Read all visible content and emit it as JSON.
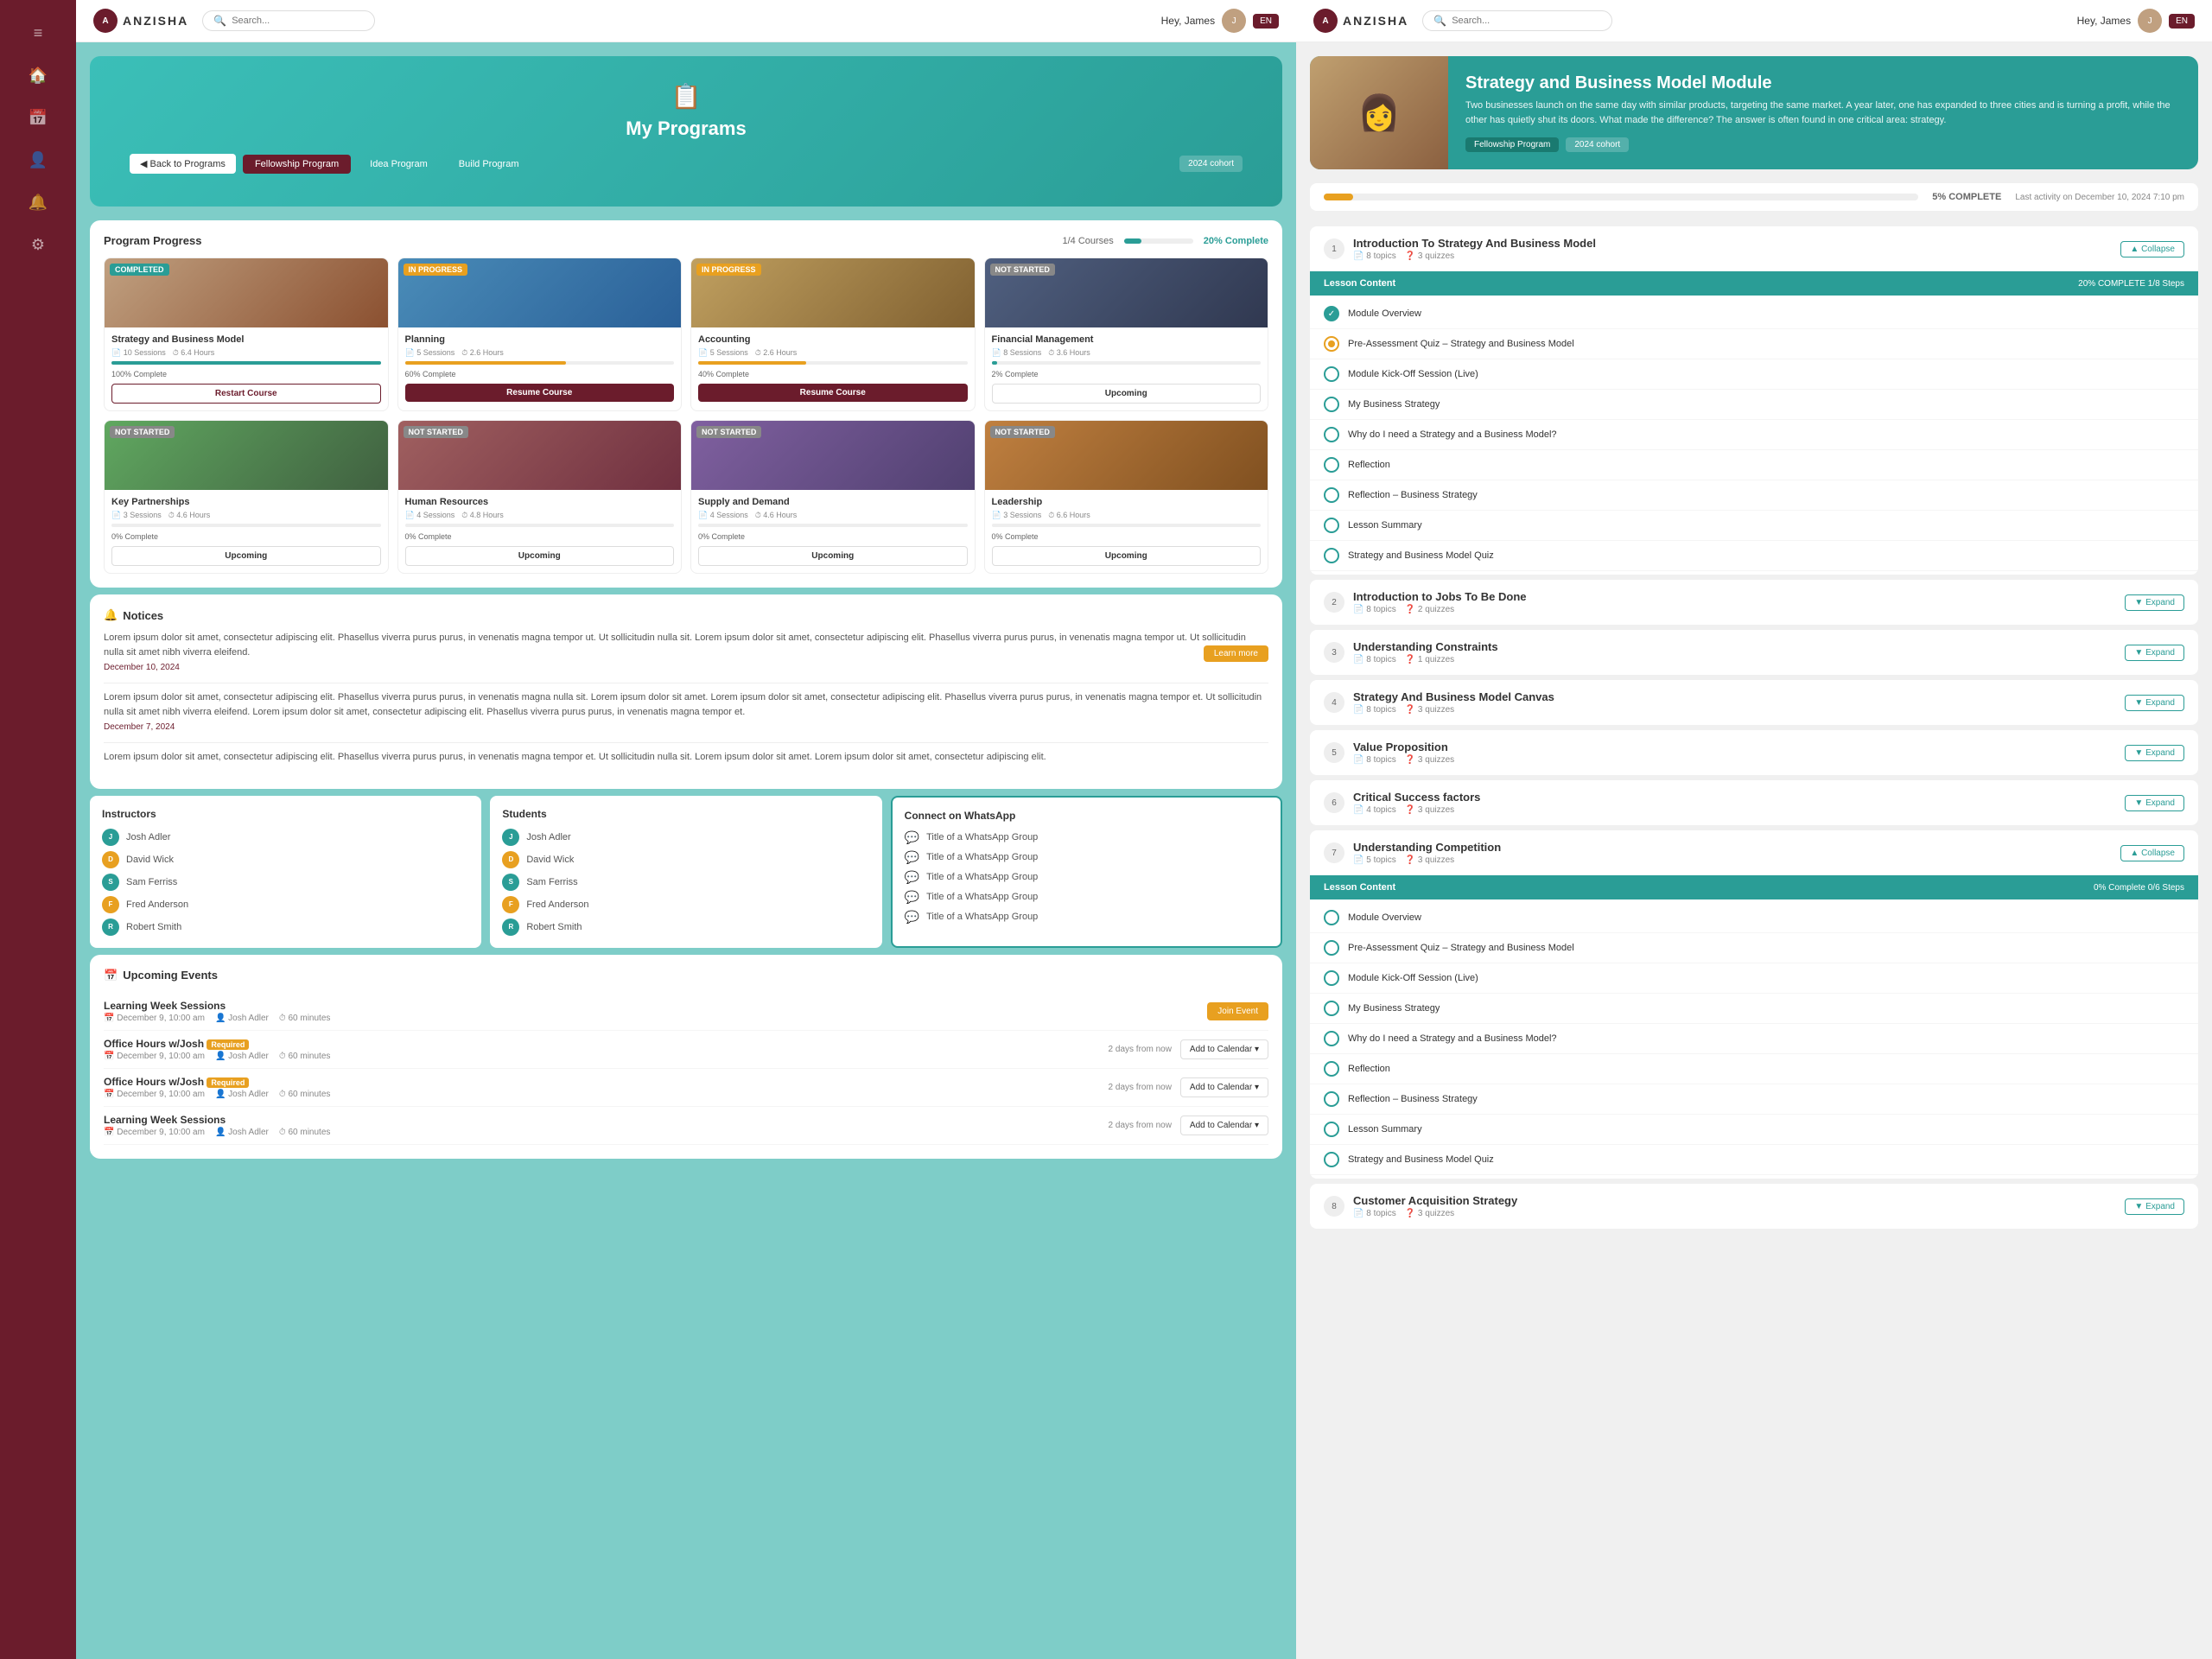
{
  "app": {
    "name": "ANZISHA",
    "lang": "EN"
  },
  "left_topbar": {
    "logo_text": "ANZISHA",
    "search_placeholder": "Search...",
    "greeting": "Hey, James",
    "avatar_initials": "J"
  },
  "right_topbar": {
    "logo_text": "ANZISHA",
    "search_placeholder": "Search...",
    "greeting": "Hey, James",
    "avatar_initials": "J",
    "lang": "EN"
  },
  "hero": {
    "icon": "📋",
    "title": "My Programs"
  },
  "program_tabs": {
    "back_label": "◀ Back to Programs",
    "tabs": [
      "Fellowship Program",
      "Idea Program",
      "Build Program"
    ],
    "active_tab": "Fellowship Program",
    "cohort": "2024 cohort"
  },
  "program_progress": {
    "title": "Program Progress",
    "courses_meta": "1/4 Courses",
    "completion": "20% Complete",
    "courses": [
      {
        "name": "Strategy and Business Model",
        "status": "COMPLETED",
        "status_class": "badge-completed",
        "sessions": "10 Sessions",
        "hours": "6.4 Hours",
        "progress": 100,
        "progress_class": "progress-green",
        "pct_text": "100% Complete",
        "btn_label": "Restart Course",
        "btn_class": "btn-restart",
        "thumb_class": "thumb-1"
      },
      {
        "name": "Planning",
        "status": "IN PROGRESS",
        "status_class": "badge-in-progress",
        "sessions": "5 Sessions",
        "hours": "2.6 Hours",
        "progress": 60,
        "progress_class": "progress-orange",
        "pct_text": "60% Complete",
        "btn_label": "Resume Course",
        "btn_class": "btn-resume",
        "thumb_class": "thumb-2"
      },
      {
        "name": "Accounting",
        "status": "IN PROGRESS",
        "status_class": "badge-in-progress",
        "sessions": "5 Sessions",
        "hours": "2.6 Hours",
        "progress": 40,
        "progress_class": "progress-orange",
        "pct_text": "40% Complete",
        "btn_label": "Resume Course",
        "btn_class": "btn-resume",
        "thumb_class": "thumb-3"
      },
      {
        "name": "Financial Management",
        "status": "NOT STARTED",
        "status_class": "badge-not-started",
        "sessions": "8 Sessions",
        "hours": "3.6 Hours",
        "progress": 2,
        "progress_class": "progress-green",
        "pct_text": "2% Complete",
        "btn_label": "Upcoming",
        "btn_class": "btn-upcoming",
        "thumb_class": "thumb-4"
      },
      {
        "name": "Key Partnerships",
        "status": "NOT STARTED",
        "status_class": "badge-not-started",
        "sessions": "3 Sessions",
        "hours": "4.6 Hours",
        "progress": 0,
        "progress_class": "progress-green",
        "pct_text": "0% Complete",
        "btn_label": "Upcoming",
        "btn_class": "btn-upcoming",
        "thumb_class": "thumb-5"
      },
      {
        "name": "Human Resources",
        "status": "NOT STARTED",
        "status_class": "badge-not-started",
        "sessions": "4 Sessions",
        "hours": "4.8 Hours",
        "progress": 0,
        "progress_class": "progress-green",
        "pct_text": "0% Complete",
        "btn_label": "Upcoming",
        "btn_class": "btn-upcoming",
        "thumb_class": "thumb-6"
      },
      {
        "name": "Supply and Demand",
        "status": "NOT STARTED",
        "status_class": "badge-not-started",
        "sessions": "4 Sessions",
        "hours": "4.6 Hours",
        "progress": 0,
        "progress_class": "progress-green",
        "pct_text": "0% Complete",
        "btn_label": "Upcoming",
        "btn_class": "btn-upcoming",
        "thumb_class": "thumb-7"
      },
      {
        "name": "Leadership",
        "status": "NOT STARTED",
        "status_class": "badge-not-started",
        "sessions": "3 Sessions",
        "hours": "6.6 Hours",
        "progress": 0,
        "progress_class": "progress-green",
        "pct_text": "0% Complete",
        "btn_label": "Upcoming",
        "btn_class": "btn-upcoming",
        "thumb_class": "thumb-8"
      }
    ]
  },
  "notices": {
    "title": "Notices",
    "icon": "🔔",
    "items": [
      {
        "text": "Lorem ipsum dolor sit amet, consectetur adipiscing elit. Phasellus viverra purus purus, in venenatis magna tempor ut. Ut sollicitudin nulla sit. Lorem ipsum dolor sit amet, consectetur adipiscing elit. Phasellus viverra purus purus, in venenatis magna tempor ut. Ut sollicitudin nulla sit amet nibh viverra eleifend.",
        "date": "December 10, 2024",
        "has_learn_more": true
      },
      {
        "text": "Lorem ipsum dolor sit amet, consectetur adipiscing elit. Phasellus viverra purus purus, in venenatis magna nulla sit. Lorem ipsum dolor sit amet. Lorem ipsum dolor sit amet, consectetur adipiscing elit. Phasellus viverra purus purus, in venenatis magna tempor et. Ut sollicitudin nulla sit amet nibh viverra eleifend. Lorem ipsum dolor sit amet, consectetur adipiscing elit. Phasellus viverra purus purus, in venenatis magna tempor et.",
        "date": "December 7, 2024",
        "has_learn_more": false
      },
      {
        "text": "Lorem ipsum dolor sit amet, consectetur adipiscing elit. Phasellus viverra purus purus, in venenatis magna tempor et. Ut sollicitudin nulla sit. Lorem ipsum dolor sit amet. Lorem ipsum dolor sit amet, consectetur adipiscing elit.",
        "date": "",
        "has_learn_more": false
      }
    ]
  },
  "instructors": {
    "title": "Instructors",
    "people": [
      {
        "name": "Josh Adler",
        "color": "dot-teal"
      },
      {
        "name": "David Wick",
        "color": "dot-orange"
      },
      {
        "name": "Sam Ferriss",
        "color": "dot-teal"
      },
      {
        "name": "Fred Anderson",
        "color": "dot-orange"
      },
      {
        "name": "Robert Smith",
        "color": "dot-teal"
      }
    ]
  },
  "students": {
    "title": "Students",
    "people": [
      {
        "name": "Josh Adler",
        "color": "dot-teal"
      },
      {
        "name": "David Wick",
        "color": "dot-orange"
      },
      {
        "name": "Sam Ferriss",
        "color": "dot-teal"
      },
      {
        "name": "Fred Anderson",
        "color": "dot-orange"
      },
      {
        "name": "Robert Smith",
        "color": "dot-teal"
      }
    ]
  },
  "whatsapp": {
    "title": "Connect on WhatsApp",
    "groups": [
      "Title of a WhatsApp Group",
      "Title of a WhatsApp Group",
      "Title of a WhatsApp Group",
      "Title of a WhatsApp Group",
      "Title of a WhatsApp Group"
    ]
  },
  "upcoming_events": {
    "title": "Upcoming Events",
    "icon": "📅",
    "events": [
      {
        "name": "Learning Week Sessions",
        "required": false,
        "date": "December 9, 10:00 am",
        "host": "Josh Adler",
        "duration": "60 minutes",
        "action": "join",
        "action_label": "Join Event",
        "timing": ""
      },
      {
        "name": "Office Hours w/Josh",
        "required": true,
        "date": "December 9, 10:00 am",
        "host": "Josh Adler",
        "duration": "60 minutes",
        "action": "calendar",
        "action_label": "Add to Calendar ▾",
        "timing": "2 days from now"
      },
      {
        "name": "Office Hours w/Josh",
        "required": true,
        "date": "December 9, 10:00 am",
        "host": "Josh Adler",
        "duration": "60 minutes",
        "action": "calendar",
        "action_label": "Add to Calendar ▾",
        "timing": "2 days from now"
      },
      {
        "name": "Learning Week Sessions",
        "required": false,
        "date": "December 9, 10:00 am",
        "host": "Josh Adler",
        "duration": "60 minutes",
        "action": "calendar",
        "action_label": "Add to Calendar ▾",
        "timing": "2 days from now"
      }
    ]
  },
  "module": {
    "title": "Strategy and Business Model Module",
    "description": "Two businesses launch on the same day with similar products, targeting the same market. A year later, one has expanded to three cities and is turning a profit, while the other has quietly shut its doors. What made the difference? The answer is often found in one critical area: strategy.",
    "tag1": "Fellowship Program",
    "tag2": "2024 cohort",
    "progress_pct": 5,
    "progress_label": "5% COMPLETE",
    "last_activity": "Last activity on December 10, 2024 7:10 pm"
  },
  "module_sections": [
    {
      "title": "Introduction To Strategy And Business Model",
      "topics": "8 topics",
      "quizzes": "3 quizzes",
      "expanded": true,
      "collapse_label": "▲ Collapse",
      "lesson_content": {
        "title": "Lesson Content",
        "progress": "20% COMPLETE",
        "steps": "1/8 Steps"
      },
      "lessons": [
        {
          "name": "Module Overview",
          "status": "done"
        },
        {
          "name": "Pre-Assessment Quiz – Strategy and Business Model",
          "status": "quiz"
        },
        {
          "name": "Module Kick-Off Session (Live)",
          "status": "empty"
        },
        {
          "name": "My Business Strategy",
          "status": "empty"
        },
        {
          "name": "Why do I need a Strategy and a Business Model?",
          "status": "empty"
        },
        {
          "name": "Reflection",
          "status": "empty"
        },
        {
          "name": "Reflection – Business Strategy",
          "status": "empty"
        },
        {
          "name": "Lesson Summary",
          "status": "empty"
        },
        {
          "name": "Strategy and Business Model Quiz",
          "status": "empty"
        }
      ]
    },
    {
      "title": "Introduction to Jobs To Be Done",
      "topics": "8 topics",
      "quizzes": "2 quizzes",
      "expanded": false,
      "expand_label": "▼ Expand"
    },
    {
      "title": "Understanding Constraints",
      "topics": "8 topics",
      "quizzes": "1 quizzes",
      "expanded": false,
      "expand_label": "▼ Expand"
    },
    {
      "title": "Strategy And Business Model Canvas",
      "topics": "8 topics",
      "quizzes": "3 quizzes",
      "expanded": false,
      "expand_label": "▼ Expand"
    },
    {
      "title": "Value Proposition",
      "topics": "8 topics",
      "quizzes": "3 quizzes",
      "expanded": false,
      "expand_label": "▼ Expand"
    },
    {
      "title": "Critical Success factors",
      "topics": "4 topics",
      "quizzes": "3 quizzes",
      "expanded": false,
      "expand_label": "▼ Expand"
    },
    {
      "title": "Understanding Competition",
      "topics": "5 topics",
      "quizzes": "3 quizzes",
      "expanded": true,
      "collapse_label": "▲ Collapse",
      "lesson_content": {
        "title": "Lesson Content",
        "progress": "0% Complete",
        "steps": "0/6 Steps"
      },
      "lessons": [
        {
          "name": "Module Overview",
          "status": "empty"
        },
        {
          "name": "Pre-Assessment Quiz – Strategy and Business Model",
          "status": "empty"
        },
        {
          "name": "Module Kick-Off Session (Live)",
          "status": "empty"
        },
        {
          "name": "My Business Strategy",
          "status": "empty"
        },
        {
          "name": "Why do I need a Strategy and a Business Model?",
          "status": "empty"
        },
        {
          "name": "Reflection",
          "status": "empty"
        },
        {
          "name": "Reflection – Business Strategy",
          "status": "empty"
        },
        {
          "name": "Lesson Summary",
          "status": "empty"
        },
        {
          "name": "Strategy and Business Model Quiz",
          "status": "empty"
        }
      ]
    },
    {
      "title": "Customer Acquisition Strategy",
      "topics": "8 topics",
      "quizzes": "3 quizzes",
      "expanded": false,
      "expand_label": "▼ Expand"
    }
  ],
  "sidebar_icons": [
    "≡",
    "🏠",
    "📅",
    "👤",
    "🔔",
    "⚙"
  ],
  "learn_more_label": "Learn more"
}
